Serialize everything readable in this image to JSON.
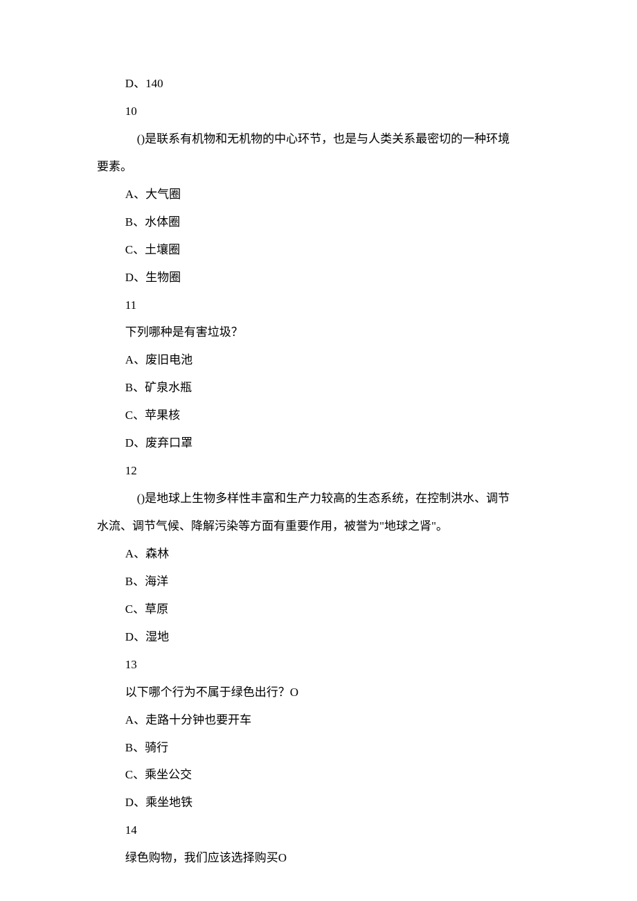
{
  "lines": [
    {
      "text": "D、140",
      "indent": true
    },
    {
      "text": "10",
      "indent": true
    },
    {
      "text": "　()是联系有机物和无机物的中心环节，也是与人类关系最密切的一种环境",
      "indent": true
    },
    {
      "text": "要素。",
      "indent": false
    },
    {
      "text": "A、大气圈",
      "indent": true
    },
    {
      "text": "B、水体圈",
      "indent": true
    },
    {
      "text": "C、土壤圈",
      "indent": true
    },
    {
      "text": "D、生物圈",
      "indent": true
    },
    {
      "text": "11",
      "indent": true
    },
    {
      "text": "下列哪种是有害垃圾？",
      "indent": true
    },
    {
      "text": "A、废旧电池",
      "indent": true
    },
    {
      "text": "B、矿泉水瓶",
      "indent": true
    },
    {
      "text": "C、苹果核",
      "indent": true
    },
    {
      "text": "D、废弃口罩",
      "indent": true
    },
    {
      "text": "12",
      "indent": true
    },
    {
      "text": "　()是地球上生物多样性丰富和生产力较高的生态系统，在控制洪水、调节",
      "indent": true
    },
    {
      "text": "水流、调节气候、降解污染等方面有重要作用，被誉为\"地球之肾\"。",
      "indent": false
    },
    {
      "text": "A、森林",
      "indent": true
    },
    {
      "text": "B、海洋",
      "indent": true
    },
    {
      "text": "C、草原",
      "indent": true
    },
    {
      "text": "D、湿地",
      "indent": true
    },
    {
      "text": "13",
      "indent": true
    },
    {
      "text": "以下哪个行为不属于绿色出行？O",
      "indent": true
    },
    {
      "text": "A、走路十分钟也要开车",
      "indent": true
    },
    {
      "text": "B、骑行",
      "indent": true
    },
    {
      "text": "C、乘坐公交",
      "indent": true
    },
    {
      "text": "D、乘坐地铁",
      "indent": true
    },
    {
      "text": "14",
      "indent": true
    },
    {
      "text": "绿色购物，我们应该选择购买O",
      "indent": true
    }
  ]
}
